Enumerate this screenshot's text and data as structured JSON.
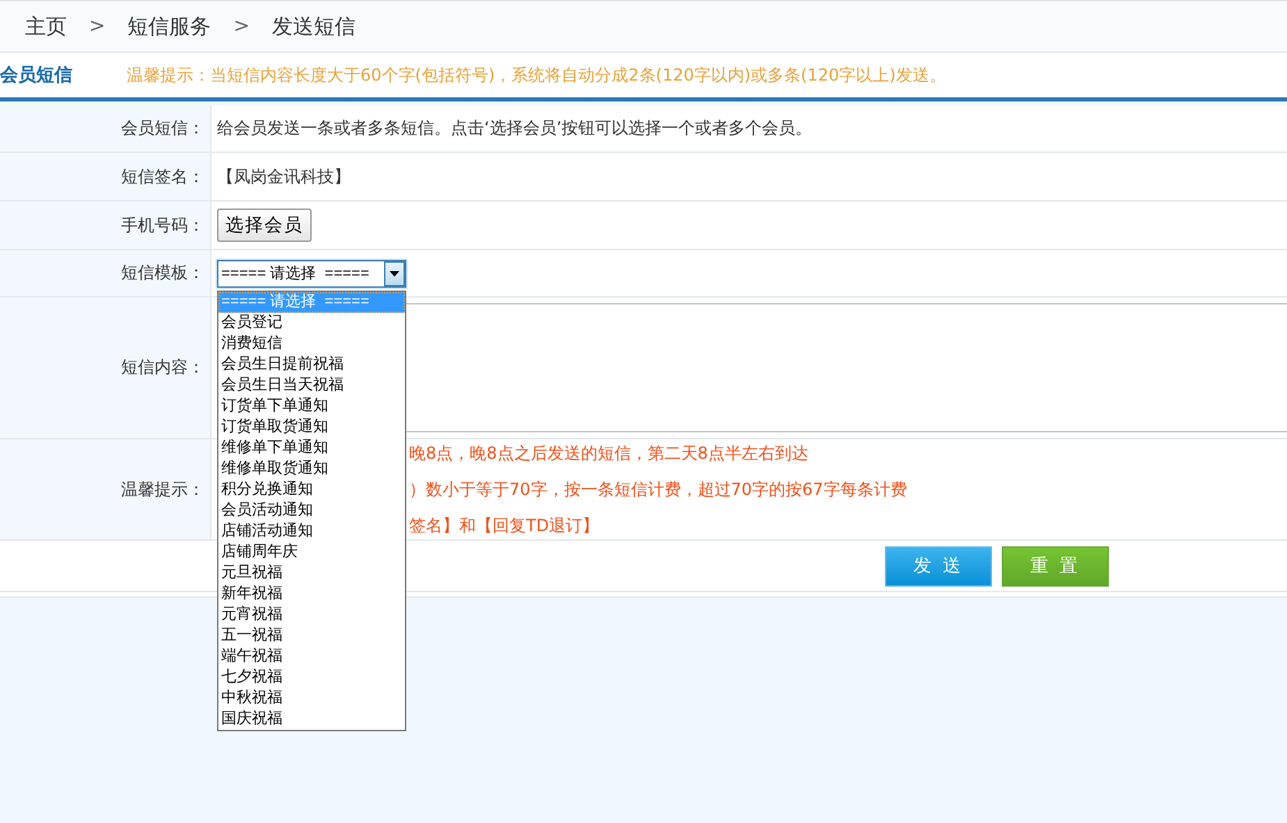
{
  "breadcrumb": [
    {
      "label": "主页"
    },
    {
      "label": "短信服务"
    },
    {
      "label": "发送短信"
    }
  ],
  "breadcrumb_separator": ">",
  "section": {
    "title": "会员短信",
    "notice": "温馨提示：当短信内容长度大于60个字(包括符号)，系统将自动分成2条(120字以内)或多条(120字以上)发送。"
  },
  "form": {
    "rows": [
      {
        "kind": "text",
        "label": "会员短信：",
        "value": "给会员发送一条或者多条短信。点击‘选择会员’按钮可以选择一个或者多个会员。"
      },
      {
        "kind": "text",
        "label": "短信签名：",
        "value": "【凤岗金讯科技】"
      },
      {
        "kind": "button",
        "label": "手机号码：",
        "button": "选择会员"
      },
      {
        "kind": "select",
        "label": "短信模板：",
        "value": "===== 请选择  =====",
        "expanded": true,
        "options": [
          {
            "label": "===== 请选择  =====",
            "selected": true
          },
          {
            "label": "会员登记",
            "selected": false
          },
          {
            "label": "消费短信",
            "selected": false
          },
          {
            "label": "会员生日提前祝福",
            "selected": false
          },
          {
            "label": "会员生日当天祝福",
            "selected": false
          },
          {
            "label": "订货单下单通知",
            "selected": false
          },
          {
            "label": "订货单取货通知",
            "selected": false
          },
          {
            "label": "维修单下单通知",
            "selected": false
          },
          {
            "label": "维修单取货通知",
            "selected": false
          },
          {
            "label": "积分兑换通知",
            "selected": false
          },
          {
            "label": "会员活动通知",
            "selected": false
          },
          {
            "label": "店铺活动通知",
            "selected": false
          },
          {
            "label": "店铺周年庆",
            "selected": false
          },
          {
            "label": "元旦祝福",
            "selected": false
          },
          {
            "label": "新年祝福",
            "selected": false
          },
          {
            "label": "元宵祝福",
            "selected": false
          },
          {
            "label": "五一祝福",
            "selected": false
          },
          {
            "label": "端午祝福",
            "selected": false
          },
          {
            "label": "七夕祝福",
            "selected": false
          },
          {
            "label": "中秋祝福",
            "selected": false
          },
          {
            "label": "国庆祝福",
            "selected": false
          }
        ]
      },
      {
        "kind": "textarea",
        "label": "短信内容："
      },
      {
        "kind": "tips",
        "label": "温馨提示：",
        "lines": [
          "晚8点，晚8点之后发送的短信，第二天8点半左右到达",
          "）数小于等于70字，按一条短信计费，超过70字的按67字每条计费",
          "签名】和【回复TD退订】"
        ]
      }
    ]
  },
  "buttons": [
    {
      "label": "发 送",
      "kind": "primary"
    },
    {
      "label": "重 置",
      "kind": "secondary"
    }
  ]
}
